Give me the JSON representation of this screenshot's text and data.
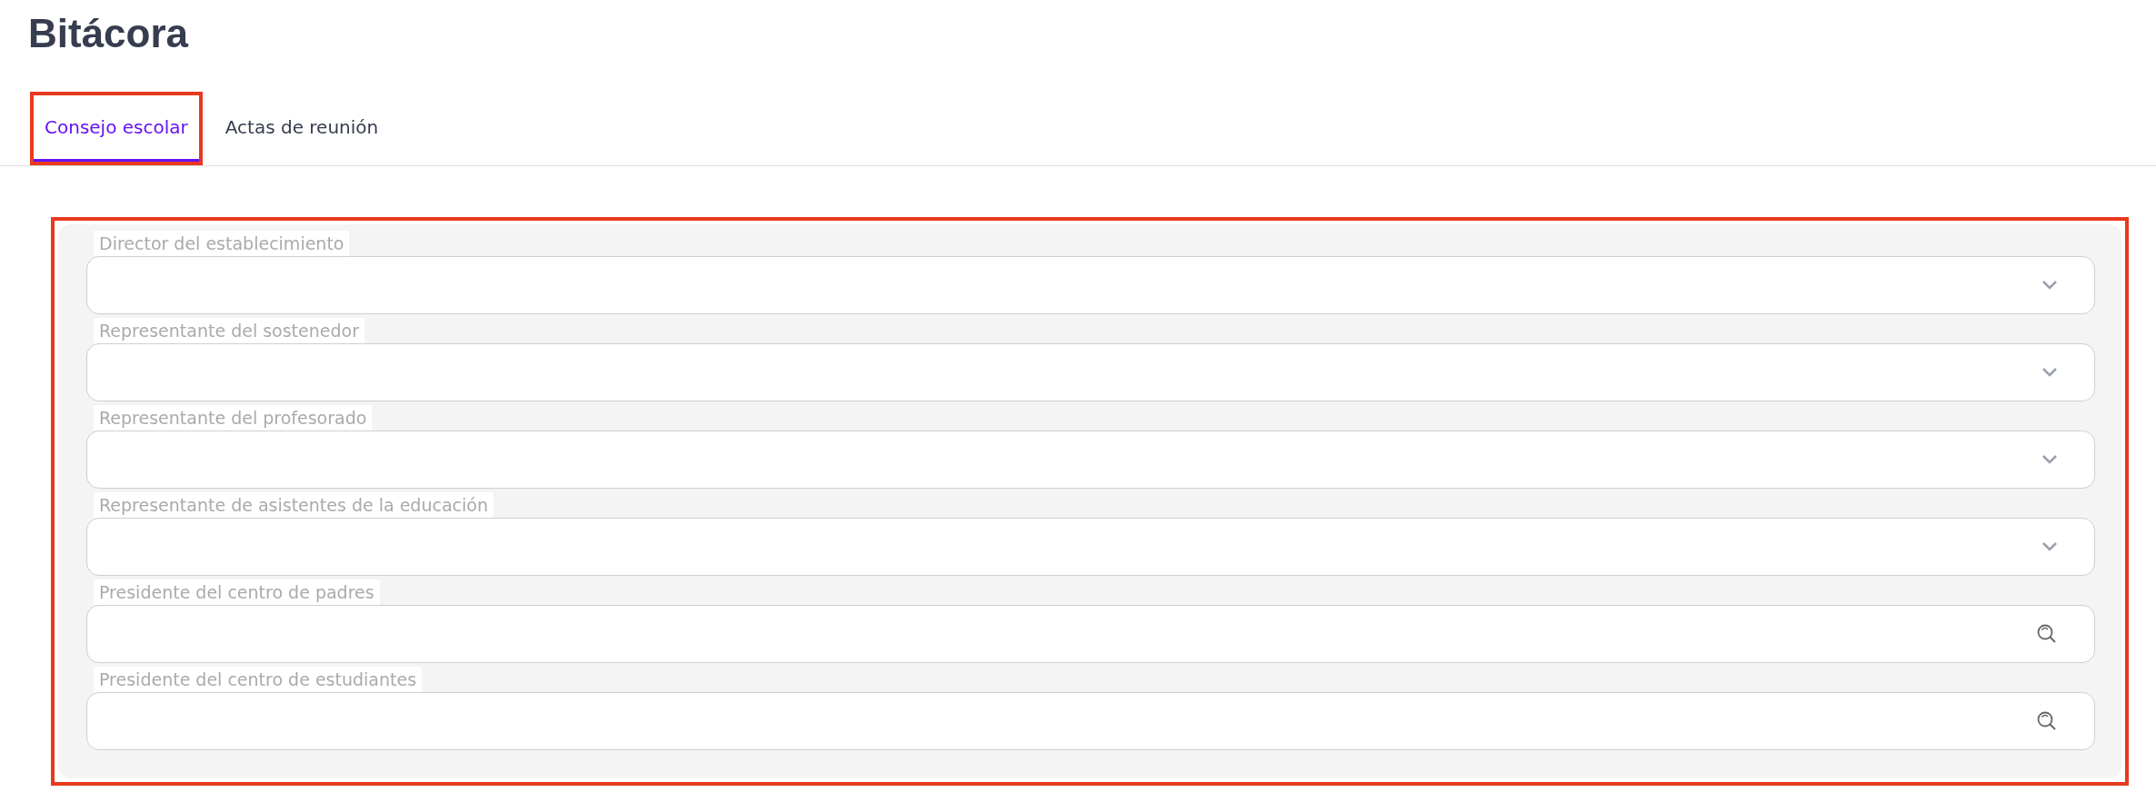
{
  "page": {
    "title": "Bitácora"
  },
  "tabs": [
    {
      "label": "Consejo escolar",
      "selected": true,
      "highlighted": true
    },
    {
      "label": "Actas de reunión",
      "selected": false,
      "highlighted": false
    }
  ],
  "form": {
    "highlighted": true,
    "fields": [
      {
        "label": "Director del establecimiento",
        "kind": "select"
      },
      {
        "label": "Representante del sostenedor",
        "kind": "select"
      },
      {
        "label": "Representante del profesorado",
        "kind": "select"
      },
      {
        "label": "Representante de asistentes de la educación",
        "kind": "select"
      },
      {
        "label": "Presidente del centro de padres",
        "kind": "search"
      },
      {
        "label": "Presidente del centro de estudiantes",
        "kind": "search"
      }
    ]
  }
}
